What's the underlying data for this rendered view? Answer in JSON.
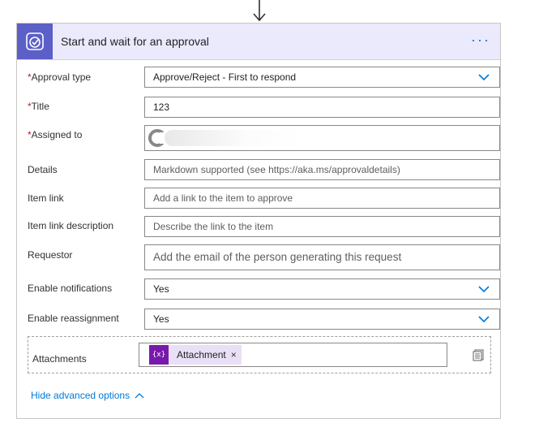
{
  "header": {
    "title": "Start and wait for an approval",
    "more_label": "···",
    "accent_color": "#5b5fc7",
    "icon": "approval-icon"
  },
  "fields": {
    "approval_type": {
      "label": "Approval type",
      "required": "*",
      "value": "Approve/Reject - First to respond"
    },
    "title": {
      "label": "Title",
      "required": "*",
      "value": "123"
    },
    "assigned_to": {
      "label": "Assigned to",
      "required": "*",
      "value": ""
    },
    "details": {
      "label": "Details",
      "placeholder": "Markdown supported (see https://aka.ms/approvaldetails)"
    },
    "item_link": {
      "label": "Item link",
      "placeholder": "Add a link to the item to approve"
    },
    "item_link_description": {
      "label": "Item link description",
      "placeholder": "Describe the link to the item"
    },
    "requestor": {
      "label": "Requestor",
      "placeholder": "Add the email of the person generating this request"
    },
    "enable_notifications": {
      "label": "Enable notifications",
      "value": "Yes"
    },
    "enable_reassignment": {
      "label": "Enable reassignment",
      "value": "Yes"
    },
    "attachments": {
      "label": "Attachments",
      "token_icon": "{x}",
      "token_label": "Attachment",
      "token_remove": "×"
    }
  },
  "footer": {
    "advanced_label": "Hide advanced options"
  }
}
